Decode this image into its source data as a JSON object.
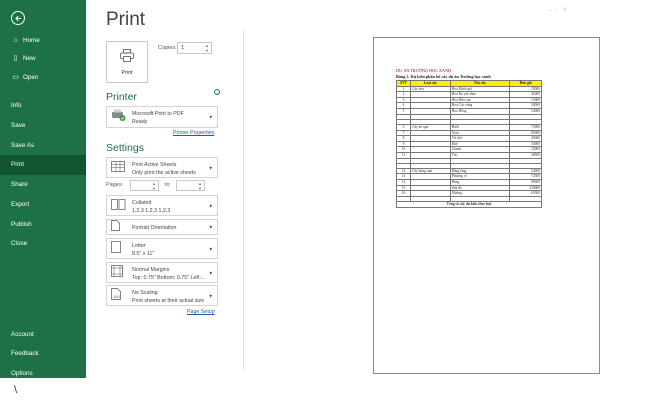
{
  "nav": {
    "items": [
      {
        "label": "Home",
        "icon": "home-icon"
      },
      {
        "label": "New",
        "icon": "new-doc-icon"
      },
      {
        "label": "Open",
        "icon": "folder-open-icon"
      },
      {
        "label": "Info"
      },
      {
        "label": "Save"
      },
      {
        "label": "Save As"
      },
      {
        "label": "Print"
      },
      {
        "label": "Share"
      },
      {
        "label": "Export"
      },
      {
        "label": "Publish"
      },
      {
        "label": "Close"
      },
      {
        "label": "Account"
      },
      {
        "label": "Feedback"
      },
      {
        "label": "Options"
      }
    ],
    "selected": "Print",
    "bg_color": "#1e7145",
    "selected_color": "#10572f"
  },
  "print": {
    "title": "Print",
    "print_button_label": "Print",
    "copies_label": "Copies:",
    "copies_value": "1"
  },
  "printer": {
    "heading": "Printer",
    "name": "Microsoft Print to PDF",
    "status": "Ready",
    "properties_link": "Printer Properties"
  },
  "settings": {
    "heading": "Settings",
    "sheets_title": "Print Active Sheets",
    "sheets_sub": "Only print the active sheets",
    "pages_label": "Pages:",
    "to_label": "to",
    "collate_title": "Collated",
    "collate_sub": "1,2,3    1,2,3    1,2,3",
    "orientation": "Portrait Orientation",
    "paper_title": "Letter",
    "paper_sub": "8.5\" x 11\"",
    "margins_title": "Normal Margins",
    "margins_sub": "Top: 0.75\" Bottom: 0.75\" Left:...",
    "scaling_title": "No Scaling",
    "scaling_sub": "Print sheets at their actual size",
    "page_setup_link": "Page Setup"
  },
  "preview": {
    "heading1": "DỰ ÁN TRƯỜNG HỌC XANH",
    "heading2": "Bảng 5. Dự kiến phân bổ cây dự án Trường học xanh",
    "columns": [
      "STT",
      "Loại cây",
      "Tên cây",
      "Đơn giá"
    ],
    "rows": [
      [
        "1",
        "Cây hoa",
        "Hoa Mười giờ",
        "25000"
      ],
      [
        "2",
        "",
        "Hoa Dạ yến thảo",
        "45000"
      ],
      [
        "3",
        "",
        "Hoa Dừa cạn",
        "15000"
      ],
      [
        "4",
        "",
        "Hoa Cúc vàng",
        "30000"
      ],
      [
        "5",
        "",
        "Hoa Hồng",
        "54000"
      ],
      [
        "",
        "",
        "",
        ""
      ],
      [
        "",
        "",
        "",
        ""
      ],
      [
        "6",
        "Cây ăn quả",
        "Bưởi",
        "75000"
      ],
      [
        "7",
        "",
        "Xoài",
        "85000"
      ],
      [
        "8",
        "",
        "Vú sữa",
        "45000"
      ],
      [
        "9",
        "",
        "Khế",
        "34000"
      ],
      [
        "10",
        "",
        "Chanh",
        "25000"
      ],
      [
        "11",
        "",
        "Táo",
        "38500"
      ],
      [
        "",
        "",
        "",
        ""
      ],
      [
        "",
        "",
        "",
        ""
      ],
      [
        "12",
        "Cây bóng mát",
        "Bằng lăng",
        "54000"
      ],
      [
        "13",
        "",
        "Phượng vĩ",
        "72300"
      ],
      [
        "14",
        "",
        "Bàng",
        "80000"
      ],
      [
        "15",
        "",
        "Sưa đỏ",
        "120000"
      ],
      [
        "16",
        "",
        "Muồng",
        "65000"
      ],
      [
        "",
        "",
        "",
        ""
      ]
    ],
    "footer": "Tổng số cây dự kiến theo loại"
  },
  "misc": {
    "bottom_char": "\\"
  }
}
